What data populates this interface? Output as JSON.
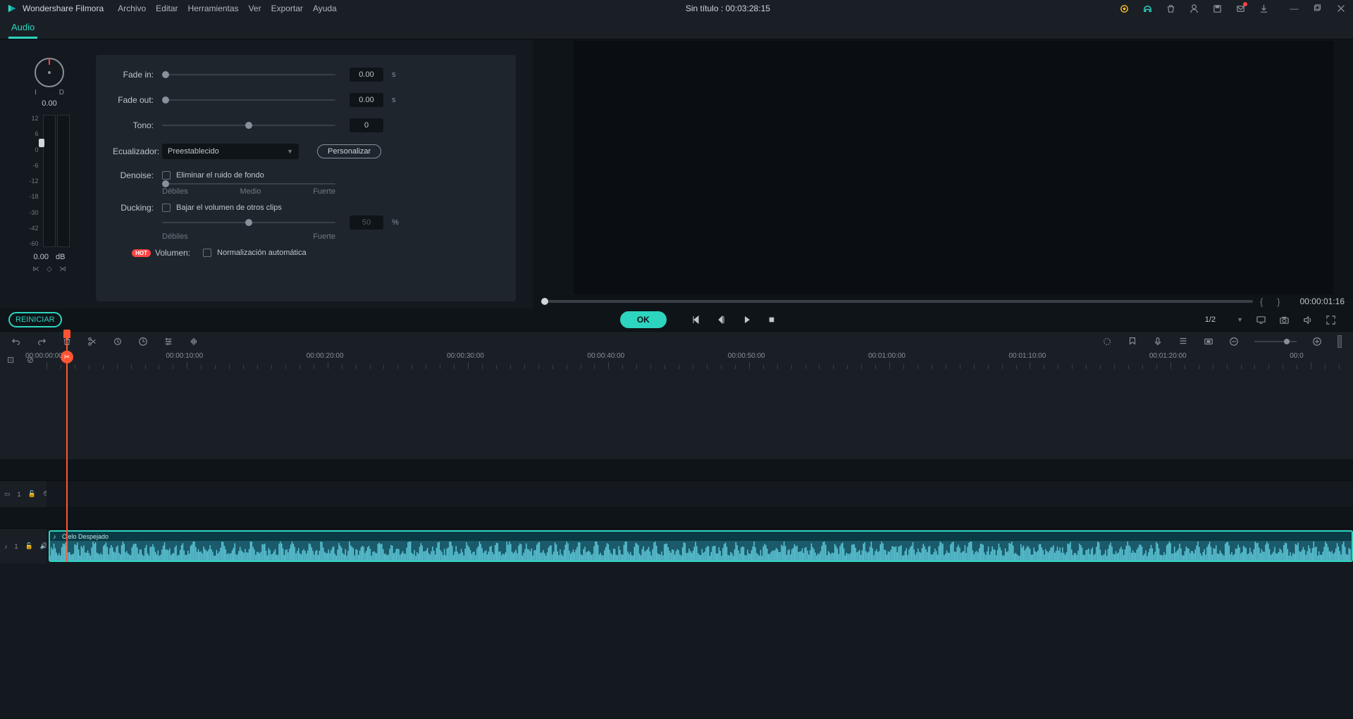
{
  "titlebar": {
    "app_name": "Wondershare Filmora",
    "menus": [
      "Archivo",
      "Editar",
      "Herramientas",
      "Ver",
      "Exportar",
      "Ayuda"
    ],
    "project_title": "Sin título : 00:03:28:15"
  },
  "tab": {
    "label": "Audio"
  },
  "knob": {
    "left_label": "I",
    "right_label": "D",
    "value": "0.00"
  },
  "meter": {
    "scale": [
      "12",
      "6",
      "0",
      "-6",
      "-12",
      "-18",
      "-30",
      "-42",
      "-60"
    ],
    "value": "0.00",
    "unit": "dB"
  },
  "controls": {
    "fade_in": {
      "label": "Fade in:",
      "value": "0.00",
      "unit": "s"
    },
    "fade_out": {
      "label": "Fade out:",
      "value": "0.00",
      "unit": "s"
    },
    "tone": {
      "label": "Tono:",
      "value": "0"
    },
    "equalizer": {
      "label": "Ecualizador:",
      "selected": "Preestablecido",
      "customize": "Personalizar"
    },
    "denoise": {
      "label": "Denoise:",
      "checkbox_label": "Eliminar el ruido de fondo",
      "low": "Débiles",
      "mid": "Medio",
      "high": "Fuerte"
    },
    "ducking": {
      "label": "Ducking:",
      "checkbox_label": "Bajar el volumen de otros clips",
      "value": "50",
      "unit": "%",
      "low": "Débiles",
      "high": "Fuerte"
    },
    "volume": {
      "badge": "HOT",
      "label": "Volumen:",
      "checkbox_label": "Normalización automática"
    }
  },
  "buttons": {
    "reset": "REINICIAR",
    "ok": "OK"
  },
  "preview": {
    "time": "00:00:01:16",
    "ratio": "1/2"
  },
  "ruler": {
    "marks": [
      "00:00:00:00",
      "00:00:10:00",
      "00:00:20:00",
      "00:00:30:00",
      "00:00:40:00",
      "00:00:50:00",
      "00:01:00:00",
      "00:01:10:00",
      "00:01:20:00",
      "00:0"
    ]
  },
  "tracks": {
    "video_label": "1",
    "audio_label": "1",
    "clip_name": "Cielo Despejado"
  }
}
